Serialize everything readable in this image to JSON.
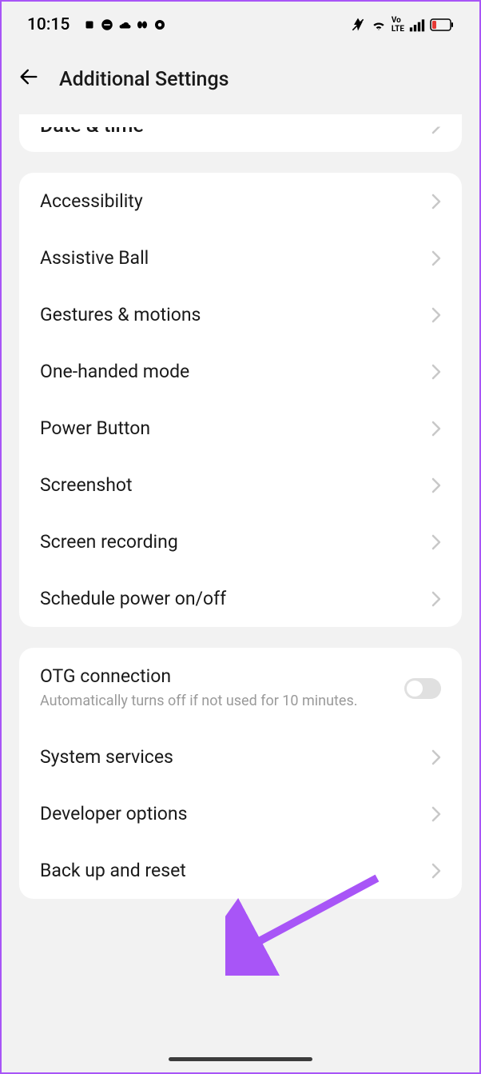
{
  "statusBar": {
    "time": "10:15"
  },
  "header": {
    "title": "Additional Settings"
  },
  "partialCard": {
    "label": "Date & time"
  },
  "group1": [
    {
      "label": "Accessibility",
      "name": "accessibility"
    },
    {
      "label": "Assistive Ball",
      "name": "assistive-ball"
    },
    {
      "label": "Gestures & motions",
      "name": "gestures-motions"
    },
    {
      "label": "One-handed mode",
      "name": "one-handed-mode"
    },
    {
      "label": "Power Button",
      "name": "power-button"
    },
    {
      "label": "Screenshot",
      "name": "screenshot"
    },
    {
      "label": "Screen recording",
      "name": "screen-recording"
    },
    {
      "label": "Schedule power on/off",
      "name": "schedule-power"
    }
  ],
  "group2": {
    "otg": {
      "label": "OTG connection",
      "subtitle": "Automatically turns off if not used for 10 minutes."
    },
    "items": [
      {
        "label": "System services",
        "name": "system-services"
      },
      {
        "label": "Developer options",
        "name": "developer-options"
      },
      {
        "label": "Back up and reset",
        "name": "back-up-reset"
      }
    ]
  }
}
